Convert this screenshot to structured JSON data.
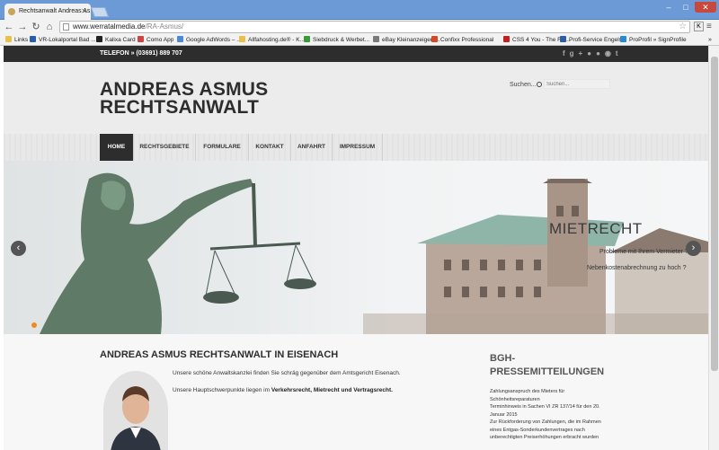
{
  "browser": {
    "tab_title": "Rechtsanwalt Andreas As",
    "url_host": "www.werratalmedia.de",
    "url_path": "/RA-Asmus/",
    "bookmarks": [
      {
        "label": "Links",
        "color": "#e8c04a"
      },
      {
        "label": "VR-Lokalportal Bad ...",
        "color": "#2a5ea8"
      },
      {
        "label": "Kalixa Card",
        "color": "#222222"
      },
      {
        "label": "Como App",
        "color": "#cc4444"
      },
      {
        "label": "Google AdWords – ...",
        "color": "#4a89dc"
      },
      {
        "label": "Allfahosting.de® - K...",
        "color": "#e8c04a"
      },
      {
        "label": "Siebdruck & Werbet...",
        "color": "#3a9a3a"
      },
      {
        "label": "eBay Kleinanzeigen ...",
        "color": "#7a7a7a"
      },
      {
        "label": "Confixx Professional",
        "color": "#d04a2a"
      },
      {
        "label": "CSS 4 You - The Fin...",
        "color": "#c02020"
      },
      {
        "label": "Profi-Service Engels",
        "color": "#2a5ea8"
      },
      {
        "label": "ProProfil » SignProfile",
        "color": "#2a8ad0"
      }
    ]
  },
  "site": {
    "phone": "TELEFON » (03691) 889 707",
    "social_icons": [
      "facebook-icon",
      "google-plus-icon",
      "flickr-icon",
      "rss-icon",
      "twitter-icon"
    ],
    "logo_line1": "ANDREAS ASMUS",
    "logo_line2": "RECHTSANWALT",
    "search_label": "Suchen...",
    "search_placeholder": "Suchen...",
    "nav": [
      "HOME",
      "RECHTSGEBIETE",
      "FORMULARE",
      "KONTAKT",
      "ANFAHRT",
      "IMPRESSUM"
    ],
    "slide": {
      "title": "MIETRECHT",
      "line1": "Probleme mit Ihrem Vermieter ?",
      "line2": "Nebenkostenabrechnung zu hoch ?"
    },
    "main_heading": "ANDREAS ASMUS RECHTSANWALT IN EISENACH",
    "para1": "Unsere schöne Anwaltskanzlei finden Sie schräg gegenüber dem Amtsgericht Eisenach.",
    "para2_prefix": "Unsere Hauptschwerpunkte liegen im ",
    "para2_bold": "Verkehrsrecht, Mietrecht und Vertragsrecht.",
    "aside_heading_1": "BGH-",
    "aside_heading_2": "PRESSEMITTEILUNGEN",
    "aside_items": [
      "Zahlungsanspruch des Mieters für",
      "Schönheitsreparaturen",
      "Terminhinweis in Sachen VI ZR 137/14 für den 20.",
      "Januar 2015",
      "Zur Rückforderung von Zahlungen, die im Rahmen",
      "eines Entgas-Sonderkundenvertrages nach",
      "unberechtigten Preiserhöhungen erbracht wurden"
    ]
  },
  "colors": {
    "dark_bar": "#2d2d2d",
    "header_bg": "#ececec",
    "slider_dot": "#f08a1c"
  }
}
